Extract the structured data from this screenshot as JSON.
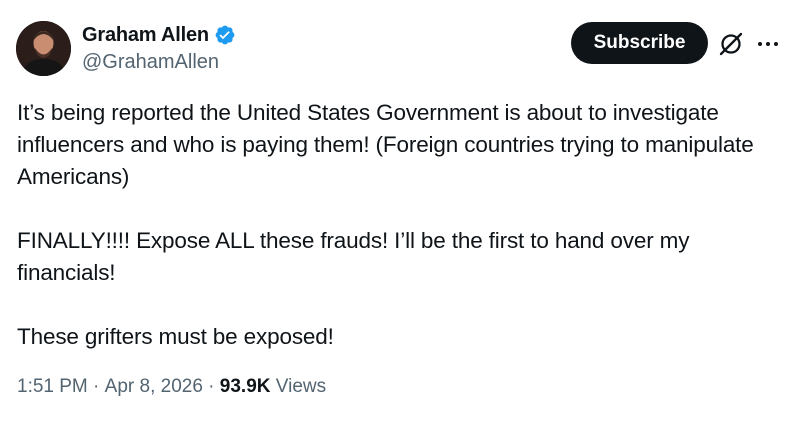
{
  "author": {
    "display_name": "Graham Allen",
    "handle": "@GrahamAllen",
    "verified": true,
    "avatar_icon": "profile-photo"
  },
  "header": {
    "subscribe_label": "Subscribe",
    "grok_icon": "grok-slash-circle-icon",
    "more_icon": "more-horizontal-icon"
  },
  "tweet": {
    "paragraphs": [
      "It’s being reported the United States Government is about to investigate influencers and who is paying them! (Foreign countries trying to manipulate Americans)",
      "FINALLY!!!! Expose ALL these frauds! I’ll be the first to hand over my financials!",
      "These grifters must be exposed!"
    ]
  },
  "meta": {
    "time": "1:51 PM",
    "separator": " · ",
    "date": "Apr 8, 2026",
    "views_count": "93.9K",
    "views_label": "Views"
  },
  "colors": {
    "text": "#0f1419",
    "secondary": "#536471",
    "verified_blue": "#1d9bf0",
    "button_bg": "#0f1419"
  }
}
